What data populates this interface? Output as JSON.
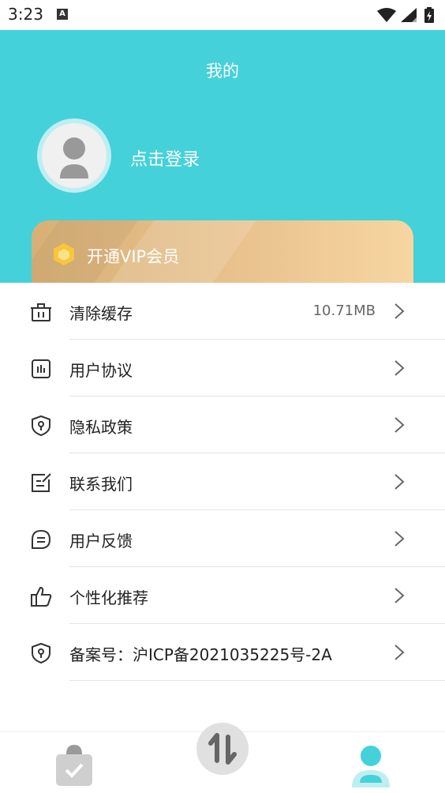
{
  "status_bar": {
    "time": "3:23",
    "notification_letter": "A"
  },
  "header": {
    "title": "我的",
    "login_prompt": "点击登录"
  },
  "vip": {
    "label": "开通VIP会员"
  },
  "menu": {
    "items": [
      {
        "label": "清除缓存",
        "value": "10.71MB",
        "icon": "trash-icon"
      },
      {
        "label": "用户协议",
        "value": "",
        "icon": "document-chart-icon"
      },
      {
        "label": "隐私政策",
        "value": "",
        "icon": "shield-icon"
      },
      {
        "label": "联系我们",
        "value": "",
        "icon": "edit-note-icon"
      },
      {
        "label": "用户反馈",
        "value": "",
        "icon": "chat-bubble-icon"
      },
      {
        "label": "个性化推荐",
        "value": "",
        "icon": "thumbs-up-icon"
      },
      {
        "label": "备案号：沪ICP备2021035225号-2A",
        "value": "",
        "icon": "shield-icon"
      }
    ]
  },
  "tab_bar": {
    "tabs": [
      {
        "icon": "clipboard-check-icon"
      },
      {
        "icon": "swap-arrows-icon"
      },
      {
        "icon": "profile-icon"
      }
    ]
  },
  "colors": {
    "accent": "#44d1da",
    "vip_gold": "#e9c28e"
  }
}
